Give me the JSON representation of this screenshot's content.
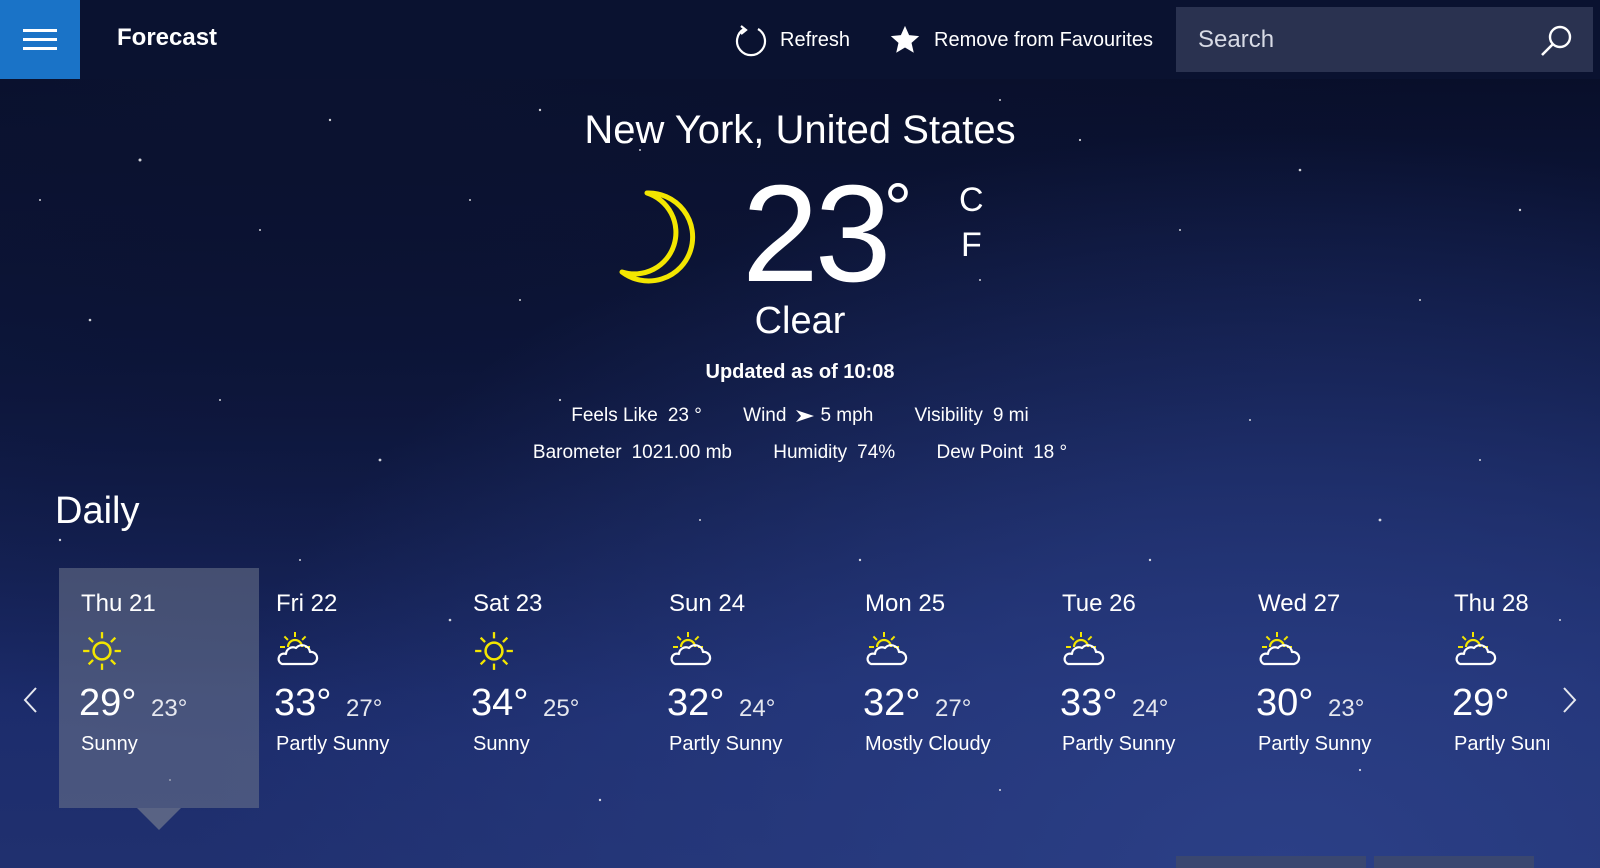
{
  "app": {
    "title": "Forecast"
  },
  "toolbar": {
    "refresh_label": "Refresh",
    "favourite_label": "Remove from Favourites"
  },
  "search": {
    "placeholder": "Search"
  },
  "current": {
    "location": "New York, United States",
    "temperature": "23",
    "degree_symbol": "°",
    "unit_c": "C",
    "unit_f": "F",
    "condition": "Clear",
    "updated": "Updated as of 10:08",
    "icon": "moon-icon",
    "details": {
      "feels_like_label": "Feels Like",
      "feels_like": "23 °",
      "wind_label": "Wind",
      "wind": "5 mph",
      "visibility_label": "Visibility",
      "visibility": "9 mi",
      "barometer_label": "Barometer",
      "barometer": "1021.00 mb",
      "humidity_label": "Humidity",
      "humidity": "74%",
      "dew_point_label": "Dew Point",
      "dew_point": "18 °"
    }
  },
  "daily": {
    "title": "Daily",
    "days": [
      {
        "name": "Thu 21",
        "hi": "29°",
        "lo": "23°",
        "cond": "Sunny",
        "icon": "sun-icon",
        "selected": true
      },
      {
        "name": "Fri 22",
        "hi": "33°",
        "lo": "27°",
        "cond": "Partly Sunny",
        "icon": "partly-sunny-icon"
      },
      {
        "name": "Sat 23",
        "hi": "34°",
        "lo": "25°",
        "cond": "Sunny",
        "icon": "sun-icon"
      },
      {
        "name": "Sun 24",
        "hi": "32°",
        "lo": "24°",
        "cond": "Partly Sunny",
        "icon": "partly-sunny-icon"
      },
      {
        "name": "Mon 25",
        "hi": "32°",
        "lo": "27°",
        "cond": "Mostly Cloudy",
        "icon": "partly-sunny-icon"
      },
      {
        "name": "Tue 26",
        "hi": "33°",
        "lo": "24°",
        "cond": "Partly Sunny",
        "icon": "partly-sunny-icon"
      },
      {
        "name": "Wed 27",
        "hi": "30°",
        "lo": "23°",
        "cond": "Partly Sunny",
        "icon": "partly-sunny-icon"
      },
      {
        "name": "Thu 28",
        "hi": "29°",
        "lo": "",
        "cond": "Partly Sunny",
        "icon": "partly-sunny-icon"
      }
    ]
  },
  "colors": {
    "accent": "#1a73c7",
    "topbar": "#0a1230",
    "sun": "#f3e600"
  }
}
